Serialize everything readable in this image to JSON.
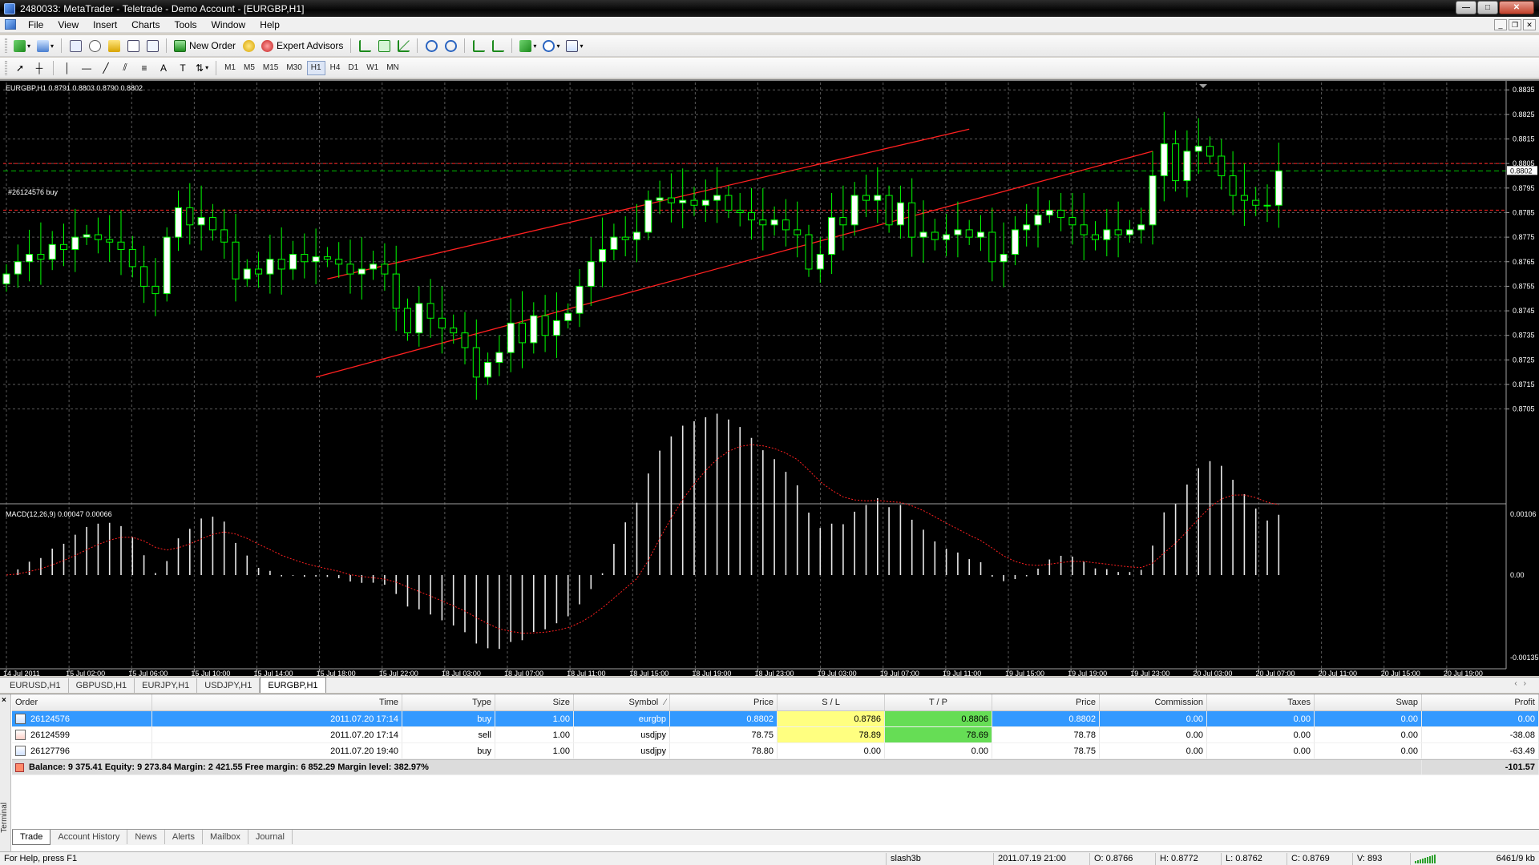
{
  "window": {
    "title": "2480033: MetaTrader - Teletrade - Demo Account - [EURGBP,H1]",
    "buttons": {
      "minimize": "—",
      "maximize": "□",
      "close": "✕"
    }
  },
  "menu": [
    "File",
    "View",
    "Insert",
    "Charts",
    "Tools",
    "Window",
    "Help"
  ],
  "toolbar": {
    "new_order_label": "New Order",
    "expert_advisors_label": "Expert Advisors",
    "timeframes": [
      "M1",
      "M5",
      "M15",
      "M30",
      "H1",
      "H4",
      "D1",
      "W1",
      "MN"
    ],
    "active_timeframe": "H1"
  },
  "chart": {
    "info": "EURGBP,H1  0.8791 0.8803 0.8790 0.8802",
    "order_label": "#26124576 buy",
    "current_price": "0.8802",
    "macd_label": "MACD(12,26,9) 0.00047 0.00066",
    "macd_ticks": [
      "0.00106",
      "0.00",
      "-0.00135"
    ],
    "colors": {
      "bull": "#ffffff",
      "bear": "#000000",
      "wick": "#00ff00",
      "grid": "#5a5a5a",
      "channel": "#ff2020",
      "order_line": "#ff2020",
      "price_line": "#00c000"
    },
    "chart_data": {
      "type": "candlestick",
      "symbol": "EURGBP",
      "timeframe": "H1",
      "ylim": [
        0.87,
        0.8838
      ],
      "y_ticks": [
        "0.8835",
        "0.8825",
        "0.8815",
        "0.8805",
        "0.8795",
        "0.8785",
        "0.8775",
        "0.8765",
        "0.8755",
        "0.8745",
        "0.8735",
        "0.8725",
        "0.8715",
        "0.8705"
      ],
      "x_ticks": [
        "14 Jul 2011",
        "15 Jul 02:00",
        "15 Jul 06:00",
        "15 Jul 10:00",
        "15 Jul 14:00",
        "15 Jul 18:00",
        "15 Jul 22:00",
        "18 Jul 03:00",
        "18 Jul 07:00",
        "18 Jul 11:00",
        "18 Jul 15:00",
        "18 Jul 19:00",
        "18 Jul 23:00",
        "19 Jul 03:00",
        "19 Jul 07:00",
        "19 Jul 11:00",
        "19 Jul 15:00",
        "19 Jul 19:00",
        "19 Jul 23:00",
        "20 Jul 03:00",
        "20 Jul 07:00",
        "20 Jul 11:00",
        "20 Jul 15:00",
        "20 Jul 19:00"
      ],
      "close": [
        0.876,
        0.8765,
        0.8768,
        0.8766,
        0.8772,
        0.877,
        0.8775,
        0.8776,
        0.8774,
        0.8773,
        0.877,
        0.8763,
        0.8755,
        0.8752,
        0.8775,
        0.8787,
        0.878,
        0.8783,
        0.8778,
        0.8773,
        0.8758,
        0.8762,
        0.876,
        0.8766,
        0.8762,
        0.8768,
        0.8765,
        0.8767,
        0.8766,
        0.8764,
        0.876,
        0.8762,
        0.8764,
        0.876,
        0.8746,
        0.8736,
        0.8748,
        0.8742,
        0.8738,
        0.8736,
        0.873,
        0.8718,
        0.8724,
        0.8728,
        0.874,
        0.8732,
        0.8743,
        0.8735,
        0.8741,
        0.8744,
        0.8755,
        0.8765,
        0.877,
        0.8775,
        0.8774,
        0.8777,
        0.879,
        0.8791,
        0.8789,
        0.879,
        0.8788,
        0.879,
        0.8792,
        0.8786,
        0.8785,
        0.8782,
        0.878,
        0.8782,
        0.8778,
        0.8776,
        0.8762,
        0.8768,
        0.8783,
        0.878,
        0.8792,
        0.879,
        0.8792,
        0.878,
        0.8789,
        0.8775,
        0.8777,
        0.8774,
        0.8776,
        0.8778,
        0.8775,
        0.8777,
        0.8765,
        0.8768,
        0.8778,
        0.878,
        0.8784,
        0.8786,
        0.8783,
        0.878,
        0.8776,
        0.8774,
        0.8778,
        0.8776,
        0.8778,
        0.878,
        0.88,
        0.8813,
        0.8798,
        0.881,
        0.8812,
        0.8808,
        0.88,
        0.8792,
        0.879,
        0.8788,
        0.8788,
        0.8802
      ]
    }
  },
  "chart_tabs": [
    "EURUSD,H1",
    "GBPUSD,H1",
    "EURJPY,H1",
    "USDJPY,H1",
    "EURGBP,H1"
  ],
  "active_chart_tab": "EURGBP,H1",
  "terminal": {
    "side_label": "Terminal",
    "columns": [
      "Order",
      "Time",
      "Type",
      "Size",
      "Symbol",
      "Price",
      "S / L",
      "T / P",
      "Price",
      "Commission",
      "Taxes",
      "Swap",
      "Profit"
    ],
    "rows": [
      {
        "order": "26124576",
        "time": "2011.07.20 17:14",
        "type": "buy",
        "size": "1.00",
        "symbol": "eurgbp",
        "price": "0.8802",
        "sl": "0.8786",
        "tp": "0.8806",
        "cprice": "0.8802",
        "commission": "0.00",
        "taxes": "0.00",
        "swap": "0.00",
        "profit": "0.00"
      },
      {
        "order": "26124599",
        "time": "2011.07.20 17:14",
        "type": "sell",
        "size": "1.00",
        "symbol": "usdjpy",
        "price": "78.75",
        "sl": "78.89",
        "tp": "78.69",
        "cprice": "78.78",
        "commission": "0.00",
        "taxes": "0.00",
        "swap": "0.00",
        "profit": "-38.08"
      },
      {
        "order": "26127796",
        "time": "2011.07.20 19:40",
        "type": "buy",
        "size": "1.00",
        "symbol": "usdjpy",
        "price": "78.80",
        "sl": "0.00",
        "tp": "0.00",
        "cprice": "78.75",
        "commission": "0.00",
        "taxes": "0.00",
        "swap": "0.00",
        "profit": "-63.49"
      }
    ],
    "balance_text": "Balance: 9 375.41  Equity: 9 273.84  Margin: 2 421.55  Free margin: 6 852.29  Margin level: 382.97%",
    "balance_profit": "-101.57",
    "tabs": [
      "Trade",
      "Account History",
      "News",
      "Alerts",
      "Mailbox",
      "Journal"
    ],
    "active_tab": "Trade"
  },
  "status": {
    "help": "For Help, press F1",
    "profile": "slash3b",
    "time": "2011.07.19 21:00",
    "open": "O: 0.8766",
    "high": "H: 0.8772",
    "low": "L: 0.8762",
    "close": "C: 0.8769",
    "volume": "V: 893",
    "traffic": "6461/9 kb"
  }
}
